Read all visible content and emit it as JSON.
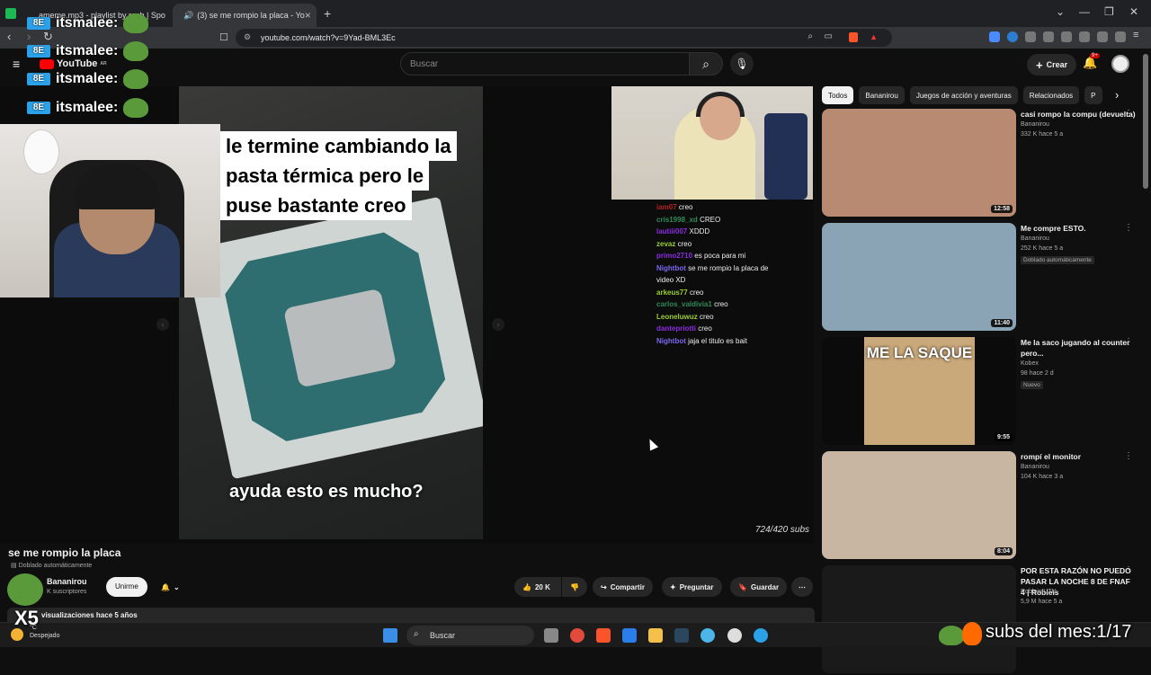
{
  "browser": {
    "tabs": [
      {
        "title": "ameme.mp3 - playlist by rosb | Spo"
      },
      {
        "title": "(3) se me rompio la placa - Yo"
      }
    ],
    "url": "youtube.com/watch?v=9Yad-BML3Ec"
  },
  "overlay": {
    "chat_user": "itsmalee:",
    "youtube_label": "YouTube",
    "youtube_region": "AR",
    "badge_text": "8E"
  },
  "youtube": {
    "search_placeholder": "Buscar",
    "create_label": "Crear",
    "notif_count": "9+"
  },
  "video": {
    "caption_lines": [
      "le termine cambiando la",
      "pasta térmica pero le",
      "puse bastante creo"
    ],
    "subtitle": "ayuda esto es mucho?",
    "subs_counter": "724/420 subs",
    "title": "se me rompio la placa",
    "dubbed": "Doblado automáticamente",
    "channel": "Bananirou",
    "channel_subs": "K suscriptores",
    "join_label": "Unirme",
    "likes": "20 K",
    "share_label": "Compartir",
    "ask_label": "Preguntar",
    "save_label": "Guardar",
    "description_meta": "visualizaciones  hace 5 años"
  },
  "stream_chat": [
    {
      "user": "iam07",
      "msg": "creo",
      "color": "#b22222"
    },
    {
      "user": "cris1998_xd",
      "msg": "CREO",
      "color": "#2e8b57"
    },
    {
      "user": "lautiii007",
      "msg": "XDDD",
      "color": "#8a2be2"
    },
    {
      "user": "zevaz",
      "msg": "creo",
      "color": "#9acd32"
    },
    {
      "user": "primo2710",
      "msg": "es poca para mi",
      "color": "#8a2be2"
    },
    {
      "user": "Nightbot",
      "msg": "se me rompio la placa de",
      "color": "#7b68ee"
    },
    {
      "user": "",
      "msg": "video XD",
      "color": "#eee"
    },
    {
      "user": "arkeus77",
      "msg": "creo",
      "color": "#9acd32"
    },
    {
      "user": "carlos_valdivia1",
      "msg": "creo",
      "color": "#2e8b57"
    },
    {
      "user": "Leoneluwuz",
      "msg": "creo",
      "color": "#9acd32"
    },
    {
      "user": "dantepriotti",
      "msg": "creo",
      "color": "#8a2be2"
    },
    {
      "user": "Nightbot",
      "msg": "jaja el titulo es bait",
      "color": "#7b68ee"
    }
  ],
  "chips": [
    "Todos",
    "Bananirou",
    "Juegos de acción y aventuras",
    "Relacionados",
    "P"
  ],
  "recommendations": [
    {
      "title": "casi rompo la compu (devuelta)",
      "channel": "Bananirou",
      "meta": "332 K  hace 5 a",
      "duration": "12:58",
      "badge": ""
    },
    {
      "title": "Me compre ESTO.",
      "channel": "Bananirou",
      "meta": "252 K  hace 5 a",
      "duration": "11:40",
      "badge": "Doblado automáticamente"
    },
    {
      "title": "Me la saco jugando al counter pero...",
      "channel": "Kobex",
      "meta": "98  hace 2 d",
      "duration": "9:55",
      "badge": "Nuevo",
      "thumb_text": "ME LA SAQUE"
    },
    {
      "title": "rompí el monitor",
      "channel": "Bananirou",
      "meta": "104 K  hace 3 a",
      "duration": "8:04",
      "badge": ""
    },
    {
      "title": "POR ESTA RAZÓN NO PUEDO PASAR LA NOCHE 8 DE FNAF 4 | Robleis",
      "channel": "RobleisIUTU",
      "meta": "5,9 M  hace 5 a",
      "duration": "",
      "badge": ""
    }
  ],
  "taskbar": {
    "search_label": "Buscar",
    "weather_temp": "°C",
    "weather_desc": "Despejado",
    "subs_month": "subs del mes:1/17",
    "multiplier": "X5"
  },
  "colors": {
    "accent_red": "#ff0000",
    "yt_bg": "#0f0f0f",
    "chip_bg": "#272727"
  }
}
